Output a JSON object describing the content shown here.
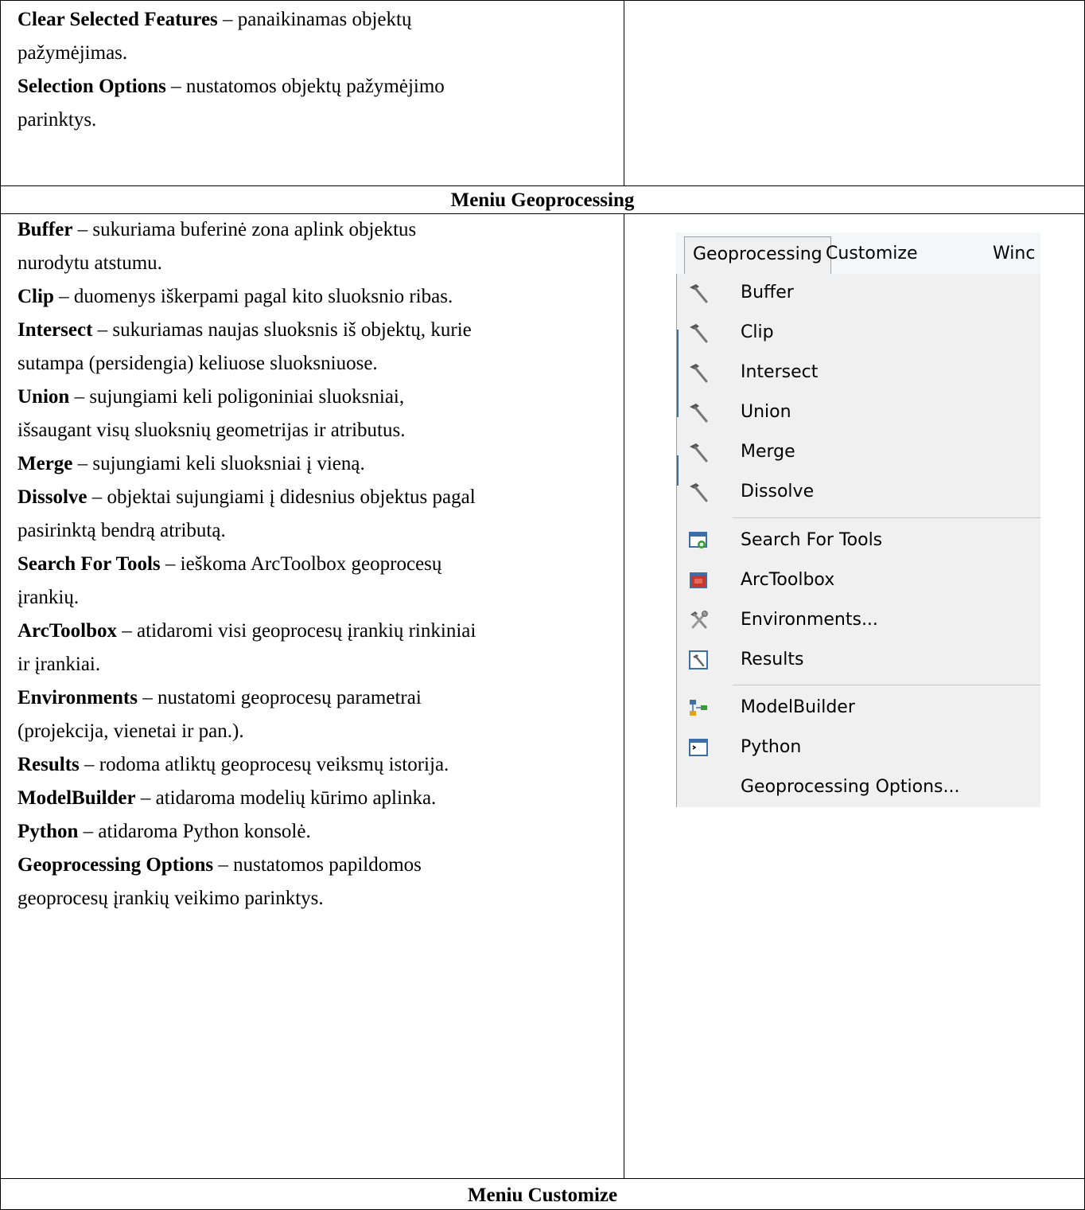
{
  "top_rows": [
    {
      "term": "Clear Selected Features",
      "desc": " – panaikinamas objektų"
    },
    {
      "term": "",
      "desc": "pažymėjimas."
    },
    {
      "term": "Selection Options",
      "desc": " – nustatomos objektų pažymėjimo"
    },
    {
      "term": "",
      "desc": "parinktys."
    }
  ],
  "section_geoprocessing": {
    "title": "Meniu Geoprocessing",
    "lines": [
      {
        "term": "Buffer",
        "desc": " – sukuriama buferinė zona aplink objektus"
      },
      {
        "term": "",
        "desc": "nurodytu atstumu."
      },
      {
        "term": "Clip",
        "desc": " – duomenys iškerpami pagal kito sluoksnio ribas."
      },
      {
        "term": "Intersect",
        "desc": " – sukuriamas naujas sluoksnis iš objektų, kurie"
      },
      {
        "term": "",
        "desc": "sutampa (persidengia) keliuose sluoksniuose."
      },
      {
        "term": "Union",
        "desc": " – sujungiami keli poligoniniai sluoksniai,"
      },
      {
        "term": "",
        "desc": "išsaugant visų sluoksnių geometrijas ir atributus."
      },
      {
        "term": "Merge",
        "desc": " – sujungiami keli sluoksniai į vieną."
      },
      {
        "term": "Dissolve",
        "desc": " – objektai sujungiami į didesnius objektus pagal"
      },
      {
        "term": "",
        "desc": "pasirinktą bendrą atributą."
      },
      {
        "term": "Search For Tools",
        "desc": " – ieškoma ArcToolbox geoprocesų"
      },
      {
        "term": "",
        "desc": "įrankių."
      },
      {
        "term": "ArcToolbox",
        "desc": " – atidaromi visi geoprocesų įrankių rinkiniai"
      },
      {
        "term": "",
        "desc": "ir įrankiai."
      },
      {
        "term": "Environments",
        "desc": " – nustatomi geoprocesų parametrai"
      },
      {
        "term": "",
        "desc": "(projekcija, vienetai ir pan.)."
      },
      {
        "term": "Results",
        "desc": " – rodoma atliktų geoprocesų veiksmų istorija."
      },
      {
        "term": "ModelBuilder",
        "desc": " – atidaroma modelių kūrimo aplinka."
      },
      {
        "term": "Python",
        "desc": " – atidaroma Python konsolė."
      },
      {
        "term": "Geoprocessing Options",
        "desc": " – nustatomos papildomos"
      },
      {
        "term": "",
        "desc": "geoprocesų įrankių veikimo parinktys."
      }
    ]
  },
  "menu_screenshot": {
    "menubar": [
      "Geoprocessing",
      "Customize",
      "Winc"
    ],
    "items": [
      {
        "label": "Buffer",
        "icon": "hammer-icon"
      },
      {
        "label": "Clip",
        "icon": "hammer-icon"
      },
      {
        "label": "Intersect",
        "icon": "hammer-icon"
      },
      {
        "label": "Union",
        "icon": "hammer-icon"
      },
      {
        "label": "Merge",
        "icon": "hammer-icon"
      },
      {
        "label": "Dissolve",
        "icon": "hammer-icon"
      },
      {
        "label": "Search For Tools",
        "icon": "search-window-icon"
      },
      {
        "label": "ArcToolbox",
        "icon": "toolbox-icon"
      },
      {
        "label": "Environments...",
        "icon": "tools-icon"
      },
      {
        "label": "Results",
        "icon": "results-icon"
      },
      {
        "label": "ModelBuilder",
        "icon": "modelbuilder-icon"
      },
      {
        "label": "Python",
        "icon": "python-window-icon"
      },
      {
        "label": "Geoprocessing Options...",
        "icon": ""
      }
    ]
  },
  "section_customize": {
    "title": "Meniu Customize"
  }
}
